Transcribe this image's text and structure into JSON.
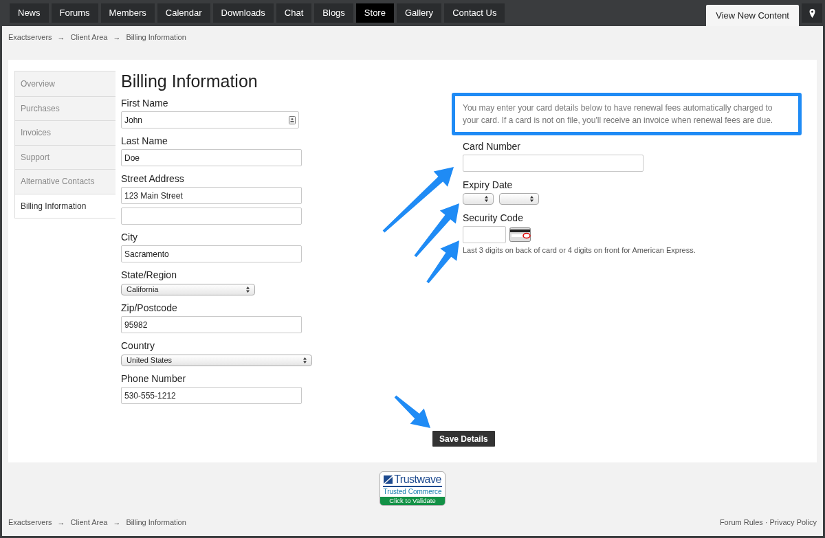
{
  "nav": {
    "tabs": [
      {
        "label": "News",
        "selected": false
      },
      {
        "label": "Forums",
        "selected": false
      },
      {
        "label": "Members",
        "selected": false
      },
      {
        "label": "Calendar",
        "selected": false
      },
      {
        "label": "Downloads",
        "selected": false
      },
      {
        "label": "Chat",
        "selected": false
      },
      {
        "label": "Blogs",
        "selected": false
      },
      {
        "label": "Store",
        "selected": true
      },
      {
        "label": "Gallery",
        "selected": false
      },
      {
        "label": "Contact Us",
        "selected": false
      }
    ],
    "view_new_content": "View New Content"
  },
  "breadcrumb": [
    "Exactservers",
    "Client Area",
    "Billing Information"
  ],
  "breadcrumb_separator": "→",
  "sidebar": {
    "items": [
      {
        "label": "Overview",
        "selected": false
      },
      {
        "label": "Purchases",
        "selected": false
      },
      {
        "label": "Invoices",
        "selected": false
      },
      {
        "label": "Support",
        "selected": false
      },
      {
        "label": "Alternative Contacts",
        "selected": false
      },
      {
        "label": "Billing Information",
        "selected": true
      }
    ]
  },
  "form": {
    "title": "Billing Information",
    "fields": [
      {
        "kind": "text",
        "label": "First Name",
        "value": "John",
        "autofill_icon": true
      },
      {
        "kind": "text",
        "label": "Last Name",
        "value": "Doe"
      },
      {
        "kind": "address",
        "label": "Street Address",
        "value": "123 Main Street"
      },
      {
        "kind": "text",
        "label": "City",
        "value": "Sacramento"
      },
      {
        "kind": "select",
        "label": "State/Region",
        "value": "California"
      },
      {
        "kind": "text",
        "label": "Zip/Postcode",
        "value": "95982"
      },
      {
        "kind": "select_wide",
        "label": "Country",
        "value": "United States"
      },
      {
        "kind": "text",
        "label": "Phone Number",
        "value": "530-555-1212"
      }
    ]
  },
  "card": {
    "note": "You may enter your card details below to have renewal fees automatically charged to your card. If a card is not on file, you'll receive an invoice when renewal fees are due.",
    "fields": [
      {
        "kind": "text",
        "label": "Card Number"
      },
      {
        "kind": "expiry",
        "label": "Expiry Date"
      },
      {
        "kind": "cvv",
        "label": "Security Code",
        "hint": "Last 3 digits on back of card or 4 digits on front for American Express."
      }
    ]
  },
  "save_button": "Save Details",
  "badge": {
    "brand": "Trustwave",
    "subtitle": "Trusted Commerce",
    "action": "Click to Validate"
  },
  "footer": {
    "breadcrumb": [
      "Exactservers",
      "Client Area",
      "Billing Information"
    ],
    "links": [
      "Forum Rules",
      "Privacy Policy"
    ],
    "link_separator": "·"
  }
}
